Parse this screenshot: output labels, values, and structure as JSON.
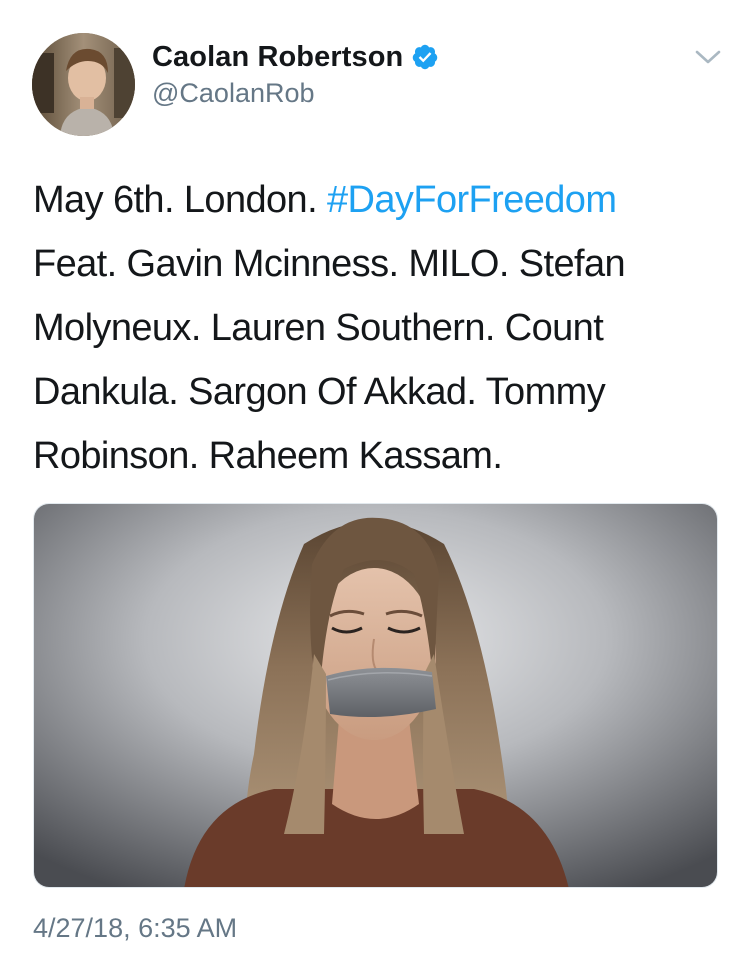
{
  "tweet": {
    "author": {
      "display_name": "Caolan Robertson",
      "handle": "@CaolanRob",
      "verified": true,
      "avatar_icon": "profile-photo"
    },
    "text_lines": [
      {
        "pre": "May 6th. London. ",
        "hashtag": "#DayForFreedom"
      },
      {
        "pre": "Feat. Gavin Mcinness. MILO. Stefan"
      },
      {
        "pre": "Molyneux. Lauren Southern. Count"
      },
      {
        "pre": "Dankula. Sargon Of Akkad. Tommy"
      },
      {
        "pre": "Robinson. Raheem Kassam."
      }
    ],
    "media": {
      "type": "photo"
    },
    "timestamp": "4/27/18, 6:35 AM"
  },
  "colors": {
    "link": "#1da1f2",
    "secondary_text": "#657786",
    "primary_text": "#14171a",
    "verified_badge": "#1da1f2"
  },
  "icons": {
    "verified": "verified-badge-icon",
    "more": "chevron-down-icon"
  }
}
